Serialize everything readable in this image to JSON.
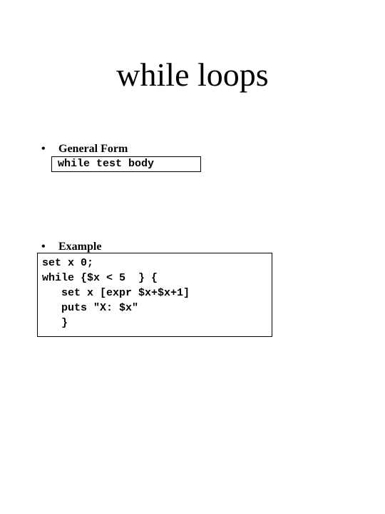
{
  "title": "while loops",
  "bullets": {
    "general": "General Form",
    "example": "Example"
  },
  "dot": "•",
  "general_form_code": "while test body",
  "example_code": "set x 0;\nwhile {$x < 5  } {\n   set x [expr $x+$x+1]\n   puts \"X: $x\"\n   }"
}
